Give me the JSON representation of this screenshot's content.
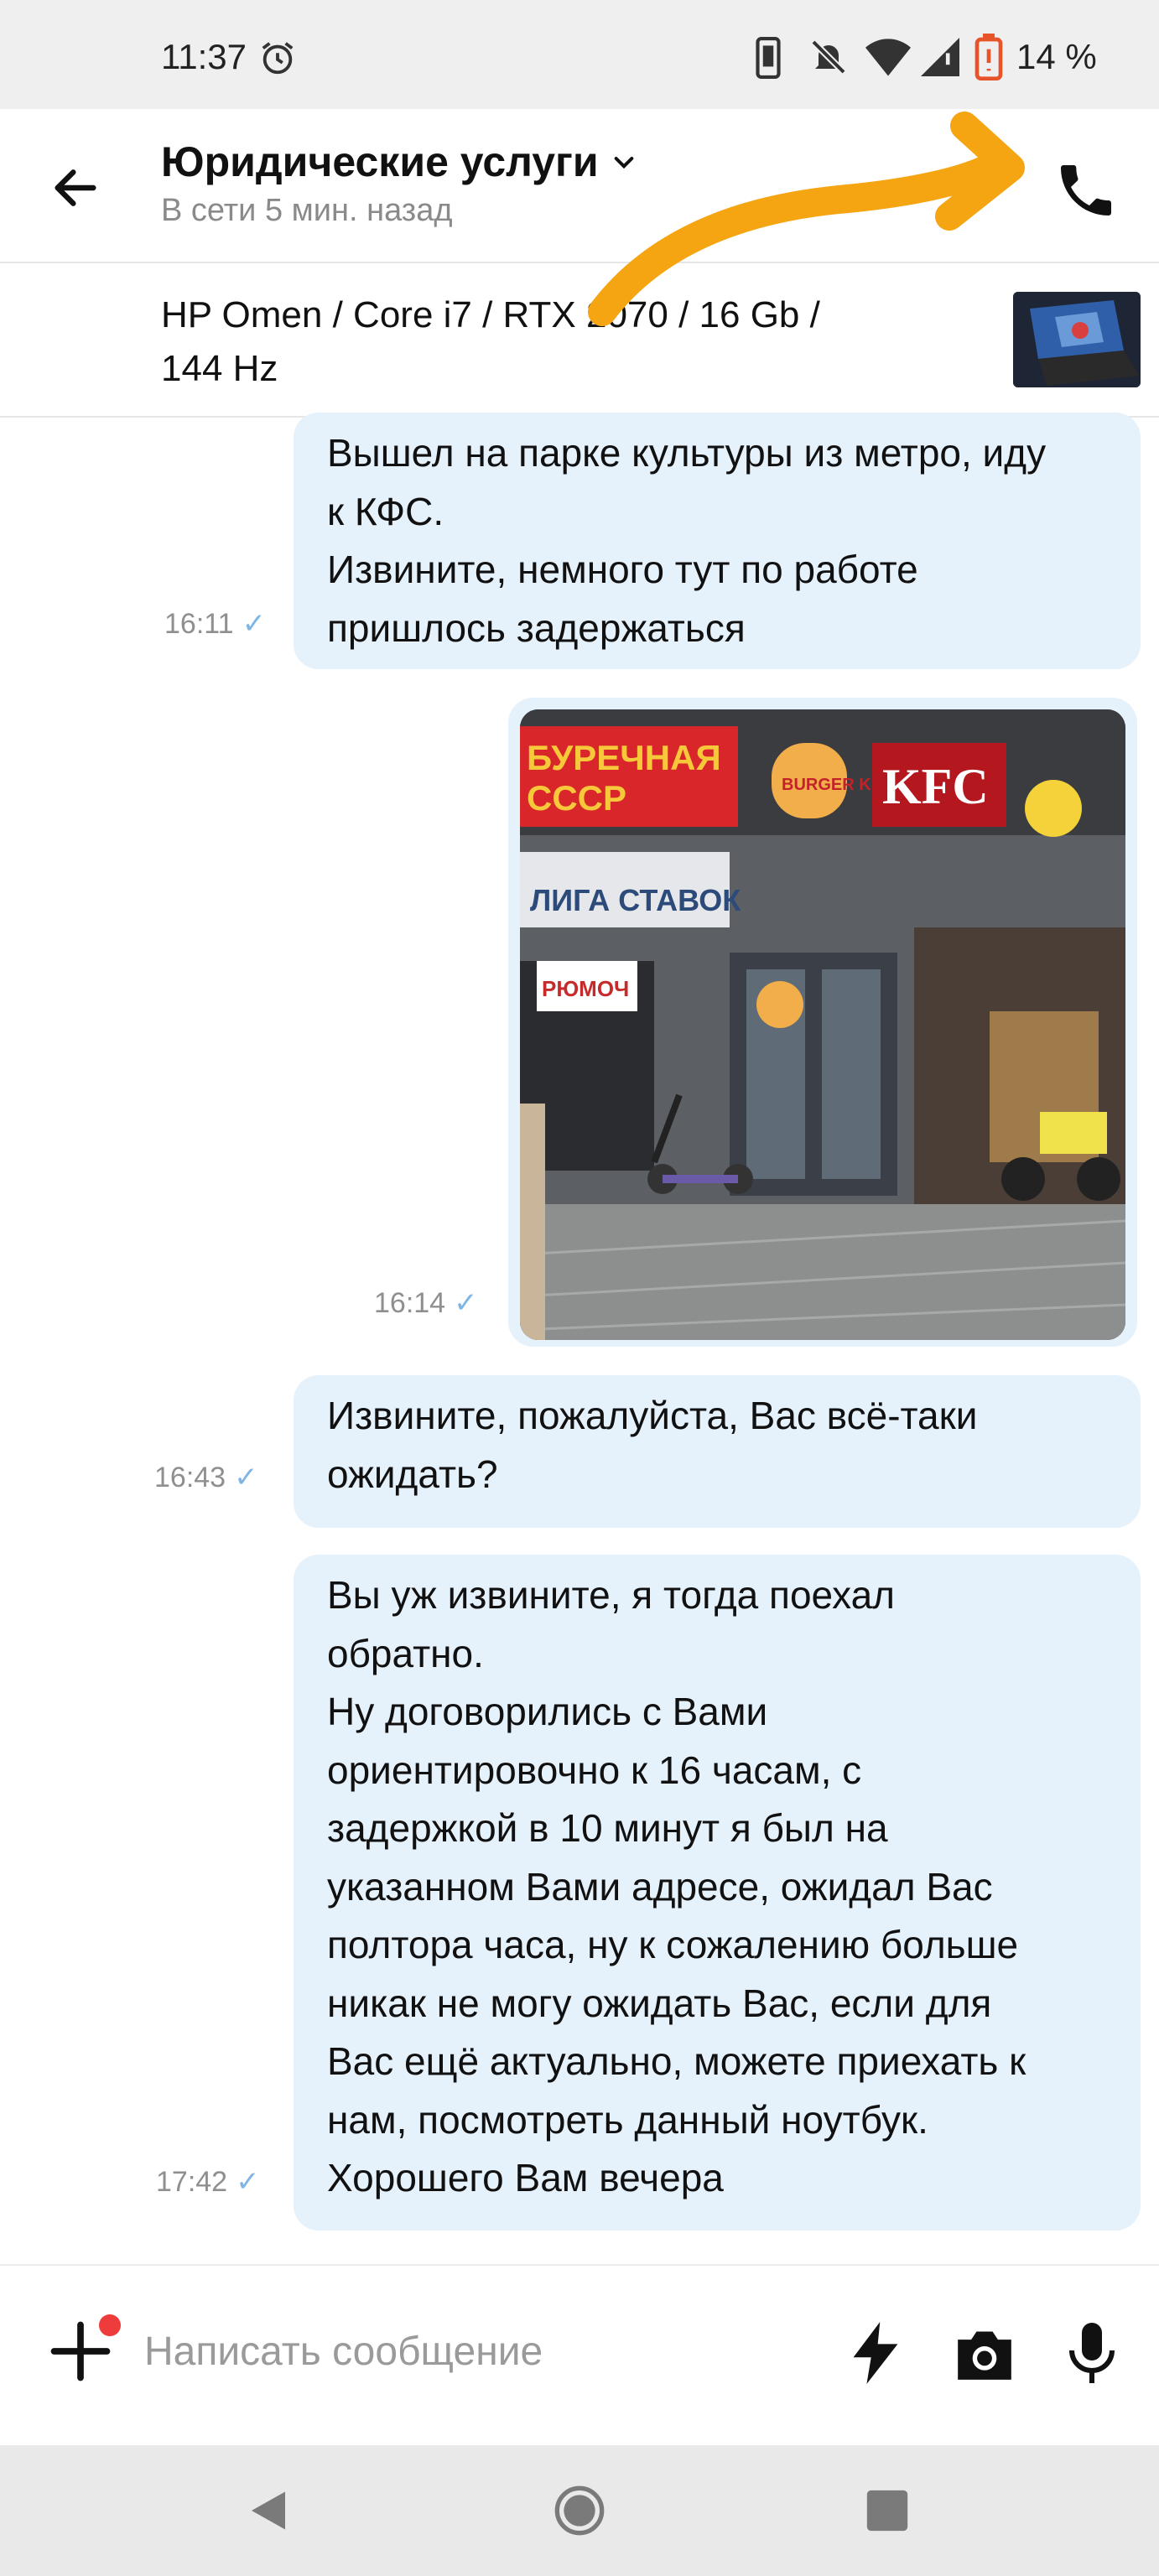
{
  "status_bar": {
    "time": "11:37",
    "battery": "14 %",
    "icons": [
      "alarm-icon",
      "phone-vibrate-icon",
      "bell-off-icon",
      "wifi-icon",
      "signal-icon",
      "battery-low-icon"
    ]
  },
  "header": {
    "title": "Юридические услуги",
    "subtitle": "В сети 5 мин. назад",
    "back_icon": "arrow-left-icon",
    "call_icon": "phone-icon"
  },
  "ad": {
    "title_line1": "HP Omen / Core i7 / RTX 2070 / 16 Gb /",
    "title_line2": "144 Hz"
  },
  "messages": [
    {
      "lines": [
        "Вышел на парке культуры из метро, иду",
        "к КФС.",
        "Извините, немного тут по работе",
        "пришлось задержаться"
      ],
      "time": "16:11"
    },
    {
      "type": "photo",
      "photo_text": {
        "sign1": "БУРЕЧНАЯ",
        "sign1b": "СССР",
        "sign2": "BURGER KING",
        "sign3": "KFC",
        "sign4": "ЛИГА СТАВОК",
        "sign5": "РЮМОЧ"
      },
      "time": "16:14"
    },
    {
      "lines": [
        "Извините, пожалуйста, Вас всё-таки",
        "ожидать?"
      ],
      "time": "16:43"
    },
    {
      "lines": [
        "Вы уж извините, я тогда поехал",
        "обратно.",
        "Ну договорились с Вами",
        "ориентировочно к 16 часам, с",
        "задержкой в 10 минут я был на",
        "указанном Вами адресе, ожидал Вас",
        "полтора часа, ну к сожалению больше",
        "никак не могу ожидать Вас, если для",
        "Вас ещё актуально, можете приехать к",
        "нам, посмотреть данный ноутбук.",
        "Хорошего Вам вечера"
      ],
      "time": "17:42"
    }
  ],
  "input": {
    "placeholder": "Написать сообщение",
    "icons": [
      "plus-icon",
      "lightning-icon",
      "camera-icon",
      "microphone-icon"
    ]
  },
  "colors": {
    "bubble": "#e5f1fb",
    "tick": "#7fb6e6",
    "annotation_arrow": "#f5a511",
    "badge": "#ee3b3b"
  }
}
